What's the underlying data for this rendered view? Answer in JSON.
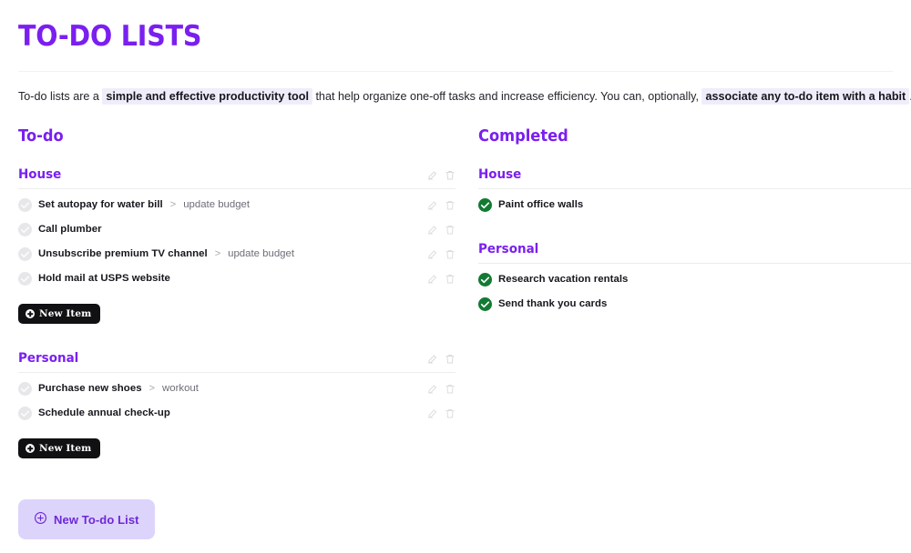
{
  "header": {
    "title": "TO-DO LISTS",
    "intro": {
      "part1": "To-do lists are a",
      "highlight1": "simple and effective productivity tool",
      "part2": "that help organize one-off tasks and increase efficiency. You can, optionally,",
      "highlight2": "associate any to-do item with a habit",
      "part3": "."
    }
  },
  "colors": {
    "accent_purple": "#7a1ff0",
    "link_purple": "#6d28d9",
    "button_lavender": "#ddd4fb",
    "highlight_lavender": "#f0edfb",
    "done_green": "#137a33",
    "pending_gray": "#e7e7ea",
    "dark_button": "#111114"
  },
  "icons": {
    "edit": "edit-icon",
    "delete": "trash-icon",
    "plus_circle": "plus-circle-icon",
    "check": "check-icon",
    "chevron": "chevron-right-icon"
  },
  "todo": {
    "title": "To-do",
    "sections": [
      {
        "name": "House",
        "new_item_label": "New Item",
        "items": [
          {
            "text": "Set autopay for water bill",
            "chevron": ">",
            "habit": "update budget"
          },
          {
            "text": "Call plumber",
            "chevron": "",
            "habit": ""
          },
          {
            "text": "Unsubscribe premium TV channel",
            "chevron": ">",
            "habit": "update budget"
          },
          {
            "text": "Hold mail at USPS website",
            "chevron": "",
            "habit": ""
          }
        ]
      },
      {
        "name": "Personal",
        "new_item_label": "New Item",
        "items": [
          {
            "text": "Purchase new shoes",
            "chevron": ">",
            "habit": "workout"
          },
          {
            "text": "Schedule annual check-up",
            "chevron": "",
            "habit": ""
          }
        ]
      }
    ],
    "new_list_label": "New To-do List"
  },
  "completed": {
    "title": "Completed",
    "sections": [
      {
        "name": "House",
        "items": [
          {
            "text": "Paint office walls"
          }
        ]
      },
      {
        "name": "Personal",
        "items": [
          {
            "text": "Research vacation rentals"
          },
          {
            "text": "Send thank you cards"
          }
        ]
      }
    ]
  }
}
